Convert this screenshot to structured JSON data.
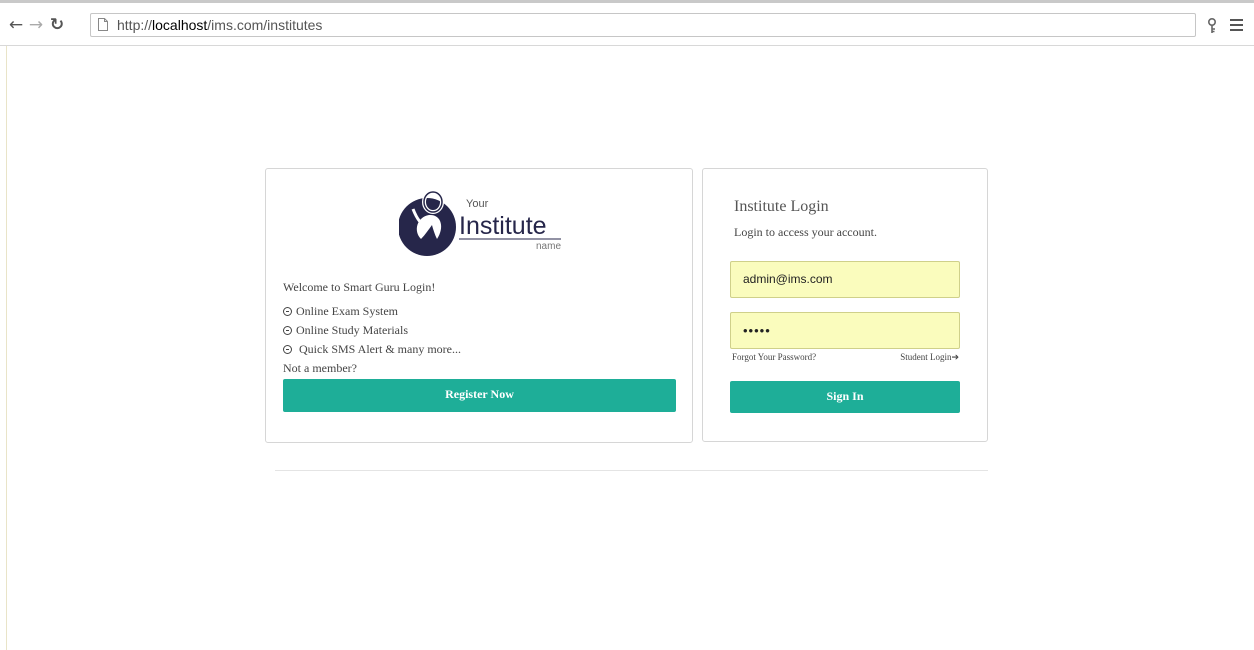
{
  "browser": {
    "url_prefix": "http://",
    "url_host": "localhost",
    "url_path": "/ims.com/institutes"
  },
  "logo": {
    "line1": "Your",
    "line2": "Institute",
    "line3": "name"
  },
  "welcome_card": {
    "welcome_text": "Welcome to Smart Guru Login!",
    "features": [
      "Online Exam System",
      "Online Study Materials",
      "Quick SMS Alert & many more..."
    ],
    "not_member_text": "Not a member?",
    "register_label": "Register Now"
  },
  "login_card": {
    "title": "Institute Login",
    "subtitle": "Login to access your account.",
    "email_value": "admin@ims.com",
    "password_value": "•••••",
    "forgot_label": "Forgot Your Password?",
    "student_login_label": "Student Login",
    "signin_label": "Sign In"
  },
  "colors": {
    "accent": "#1eae98",
    "autofill": "#fafcbd",
    "logo_dark": "#26264a"
  },
  "icons": {
    "back": "arrow-left-icon",
    "forward": "arrow-right-icon",
    "reload": "reload-icon",
    "page": "page-icon",
    "key": "key-icon",
    "menu": "hamburger-menu-icon",
    "bullet": "circle-minus-icon",
    "student_arrow": "arrow-right-icon"
  }
}
